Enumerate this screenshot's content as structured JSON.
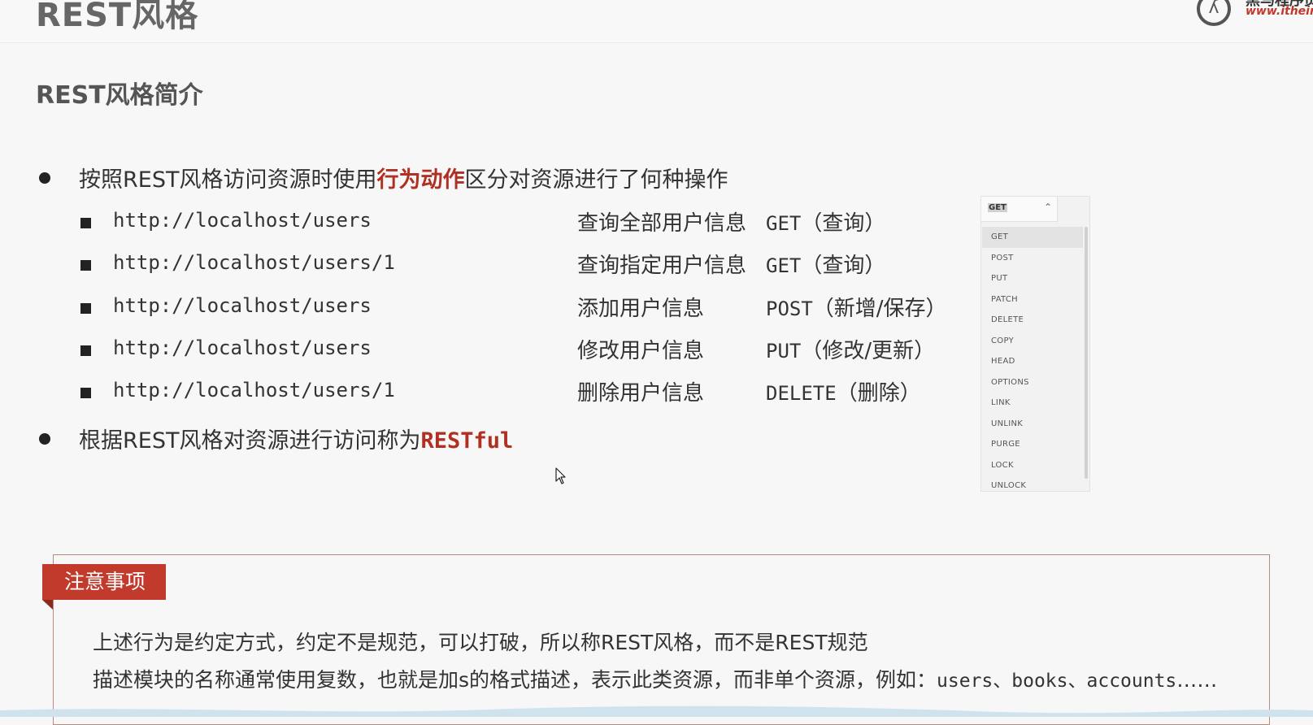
{
  "header": {
    "title": "REST风格",
    "logo_name": "黑马程序员",
    "logo_url": "www.itheima.com"
  },
  "section": {
    "title": "REST风格简介"
  },
  "bullet1": {
    "prefix": "按照REST风格访问资源时使用",
    "highlight": "行为动作",
    "suffix": "区分对资源进行了何种操作"
  },
  "rows": [
    {
      "url": "http://localhost/users",
      "desc": "查询全部用户信息",
      "method": "GET",
      "method_note": "（查询）"
    },
    {
      "url": "http://localhost/users/1",
      "desc": "查询指定用户信息",
      "method": "GET",
      "method_note": "（查询）"
    },
    {
      "url": "http://localhost/users",
      "desc": "添加用户信息",
      "method": "POST",
      "method_note": "（新增/保存）"
    },
    {
      "url": "http://localhost/users",
      "desc": "修改用户信息",
      "method": "PUT",
      "method_note": "（修改/更新）"
    },
    {
      "url": "http://localhost/users/1",
      "desc": "删除用户信息",
      "method": "DELETE",
      "method_note": "（删除）"
    }
  ],
  "bullet2": {
    "prefix": "根据REST风格对资源进行访问称为",
    "highlight": "RESTful"
  },
  "dropdown": {
    "selected": "GET",
    "options": [
      "GET",
      "POST",
      "PUT",
      "PATCH",
      "DELETE",
      "COPY",
      "HEAD",
      "OPTIONS",
      "LINK",
      "UNLINK",
      "PURGE",
      "LOCK",
      "UNLOCK"
    ]
  },
  "note": {
    "tag": "注意事项",
    "line1": "上述行为是约定方式，约定不是规范，可以打破，所以称REST风格，而不是REST规范",
    "line2_prefix": "描述模块的名称通常使用复数，也就是加s的格式描述，表示此类资源，而非单个资源，例如：",
    "line2_code": "users、books、accounts",
    "line2_suffix": "……"
  },
  "colors": {
    "accent_red": "#b03024",
    "tag_red": "#c23a2b"
  }
}
